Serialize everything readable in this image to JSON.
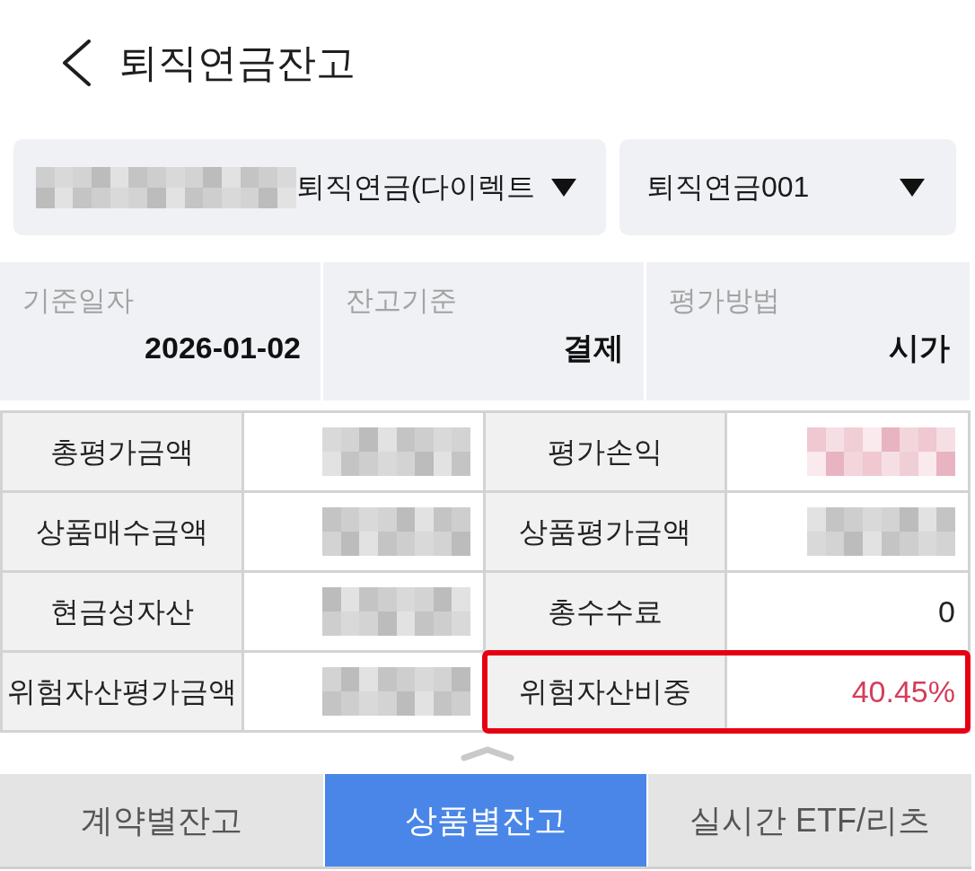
{
  "header": {
    "title": "퇴직연금잔고"
  },
  "selectors": [
    {
      "redacted_prefix": true,
      "value": "퇴직연금(다이렉트"
    },
    {
      "redacted_prefix": false,
      "value": "퇴직연금001"
    }
  ],
  "summary": [
    {
      "label": "기준일자",
      "value": "2026-01-02"
    },
    {
      "label": "잔고기준",
      "value": "결제"
    },
    {
      "label": "평가방법",
      "value": "시가"
    }
  ],
  "balance_table": {
    "rows": [
      {
        "cells": [
          {
            "label": "총평가금액",
            "kind": "redacted",
            "emphasized": false,
            "highlighted": false
          },
          {
            "label": "평가손익",
            "kind": "redacted",
            "emphasized": true,
            "highlighted": false
          }
        ]
      },
      {
        "cells": [
          {
            "label": "상품매수금액",
            "kind": "redacted",
            "emphasized": false,
            "highlighted": false
          },
          {
            "label": "상품평가금액",
            "kind": "redacted",
            "emphasized": false,
            "highlighted": false
          }
        ]
      },
      {
        "cells": [
          {
            "label": "현금성자산",
            "kind": "redacted",
            "emphasized": false,
            "highlighted": false
          },
          {
            "label": "총수수료",
            "kind": "text",
            "value": "0",
            "emphasized": false,
            "highlighted": false
          }
        ]
      },
      {
        "cells": [
          {
            "label": "위험자산평가금액",
            "kind": "redacted",
            "emphasized": false,
            "highlighted": false
          },
          {
            "label": "위험자산비중",
            "kind": "text",
            "value": "40.45%",
            "emphasized": true,
            "highlighted": true
          }
        ]
      }
    ]
  },
  "tabs": [
    {
      "label": "계약별잔고",
      "selected": false
    },
    {
      "label": "상품별잔고",
      "selected": true
    },
    {
      "label": "실시간 ETF/리츠",
      "selected": false
    }
  ]
}
